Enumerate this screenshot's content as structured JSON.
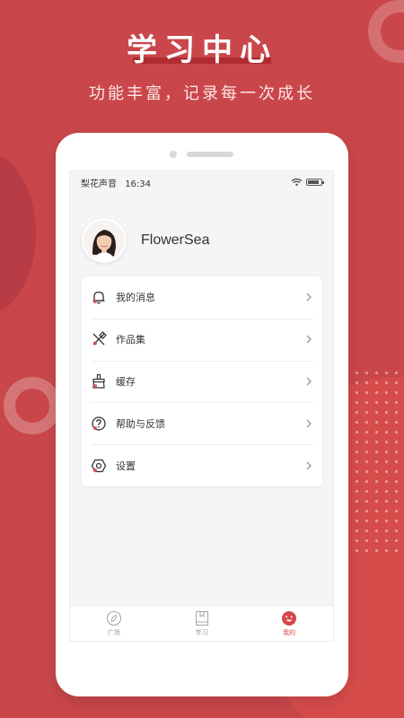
{
  "promo": {
    "headline": "学习中心",
    "subtitle": "功能丰富，记录每一次成长"
  },
  "status_bar": {
    "carrier": "梨花声音",
    "time": "16:34"
  },
  "profile": {
    "username": "FlowerSea"
  },
  "menu": {
    "items": [
      {
        "label": "我的消息",
        "icon": "bell-icon"
      },
      {
        "label": "作品集",
        "icon": "portfolio-icon"
      },
      {
        "label": "缓存",
        "icon": "broom-icon"
      },
      {
        "label": "帮助与反馈",
        "icon": "help-icon"
      },
      {
        "label": "设置",
        "icon": "settings-icon"
      }
    ]
  },
  "tabs": [
    {
      "label": "广场",
      "icon": "compass-icon",
      "active": false
    },
    {
      "label": "学习",
      "icon": "book-icon",
      "active": false
    },
    {
      "label": "我的",
      "icon": "smile-icon",
      "active": true
    }
  ],
  "colors": {
    "background": "#c9474a",
    "accent": "#d6474b"
  }
}
